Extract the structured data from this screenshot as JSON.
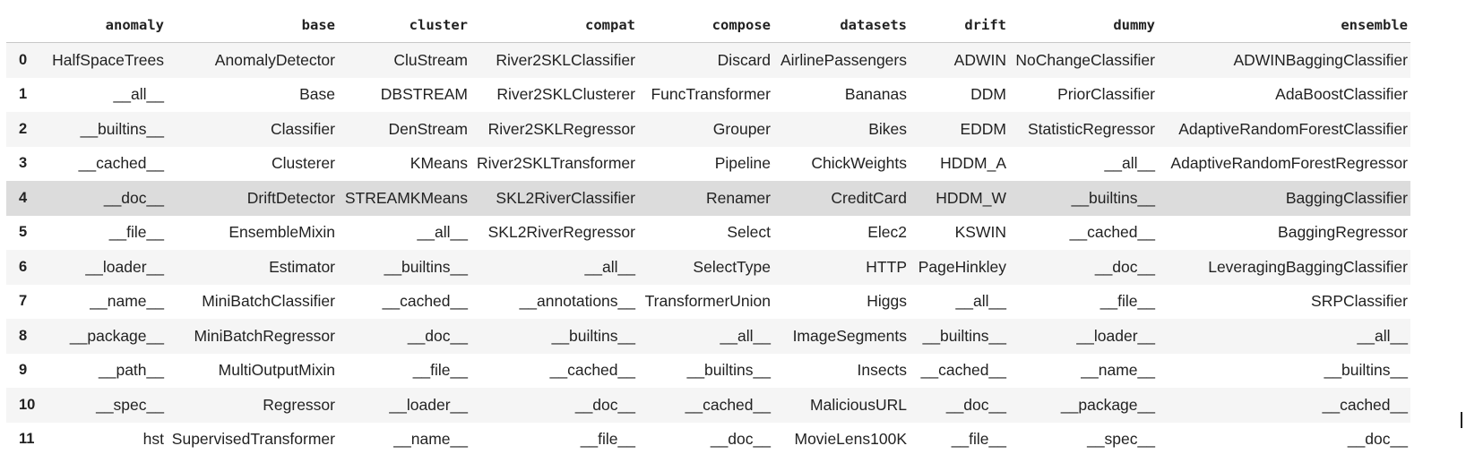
{
  "table": {
    "columns": [
      "anomaly",
      "base",
      "cluster",
      "compat",
      "compose",
      "datasets",
      "drift",
      "dummy",
      "ensemble"
    ],
    "rows": [
      {
        "index": "0",
        "cells": [
          "HalfSpaceTrees",
          "AnomalyDetector",
          "CluStream",
          "River2SKLClassifier",
          "Discard",
          "AirlinePassengers",
          "ADWIN",
          "NoChangeClassifier",
          "ADWINBaggingClassifier"
        ]
      },
      {
        "index": "1",
        "cells": [
          "__all__",
          "Base",
          "DBSTREAM",
          "River2SKLClusterer",
          "FuncTransformer",
          "Bananas",
          "DDM",
          "PriorClassifier",
          "AdaBoostClassifier"
        ]
      },
      {
        "index": "2",
        "cells": [
          "__builtins__",
          "Classifier",
          "DenStream",
          "River2SKLRegressor",
          "Grouper",
          "Bikes",
          "EDDM",
          "StatisticRegressor",
          "AdaptiveRandomForestClassifier"
        ]
      },
      {
        "index": "3",
        "cells": [
          "__cached__",
          "Clusterer",
          "KMeans",
          "River2SKLTransformer",
          "Pipeline",
          "ChickWeights",
          "HDDM_A",
          "__all__",
          "AdaptiveRandomForestRegressor"
        ]
      },
      {
        "index": "4",
        "cells": [
          "__doc__",
          "DriftDetector",
          "STREAMKMeans",
          "SKL2RiverClassifier",
          "Renamer",
          "CreditCard",
          "HDDM_W",
          "__builtins__",
          "BaggingClassifier"
        ]
      },
      {
        "index": "5",
        "cells": [
          "__file__",
          "EnsembleMixin",
          "__all__",
          "SKL2RiverRegressor",
          "Select",
          "Elec2",
          "KSWIN",
          "__cached__",
          "BaggingRegressor"
        ]
      },
      {
        "index": "6",
        "cells": [
          "__loader__",
          "Estimator",
          "__builtins__",
          "__all__",
          "SelectType",
          "HTTP",
          "PageHinkley",
          "__doc__",
          "LeveragingBaggingClassifier"
        ]
      },
      {
        "index": "7",
        "cells": [
          "__name__",
          "MiniBatchClassifier",
          "__cached__",
          "__annotations__",
          "TransformerUnion",
          "Higgs",
          "__all__",
          "__file__",
          "SRPClassifier"
        ]
      },
      {
        "index": "8",
        "cells": [
          "__package__",
          "MiniBatchRegressor",
          "__doc__",
          "__builtins__",
          "__all__",
          "ImageSegments",
          "__builtins__",
          "__loader__",
          "__all__"
        ]
      },
      {
        "index": "9",
        "cells": [
          "__path__",
          "MultiOutputMixin",
          "__file__",
          "__cached__",
          "__builtins__",
          "Insects",
          "__cached__",
          "__name__",
          "__builtins__"
        ]
      },
      {
        "index": "10",
        "cells": [
          "__spec__",
          "Regressor",
          "__loader__",
          "__doc__",
          "__cached__",
          "MaliciousURL",
          "__doc__",
          "__package__",
          "__cached__"
        ]
      },
      {
        "index": "11",
        "cells": [
          "hst",
          "SupervisedTransformer",
          "__name__",
          "__file__",
          "__doc__",
          "MovieLens100K",
          "__file__",
          "__spec__",
          "__doc__"
        ]
      }
    ],
    "hovered_row_index": 4
  },
  "colors": {
    "striped_row": "#f5f5f5",
    "hovered_row": "#dcdcdc",
    "header_border": "#c8c8c8",
    "text": "#222222"
  }
}
